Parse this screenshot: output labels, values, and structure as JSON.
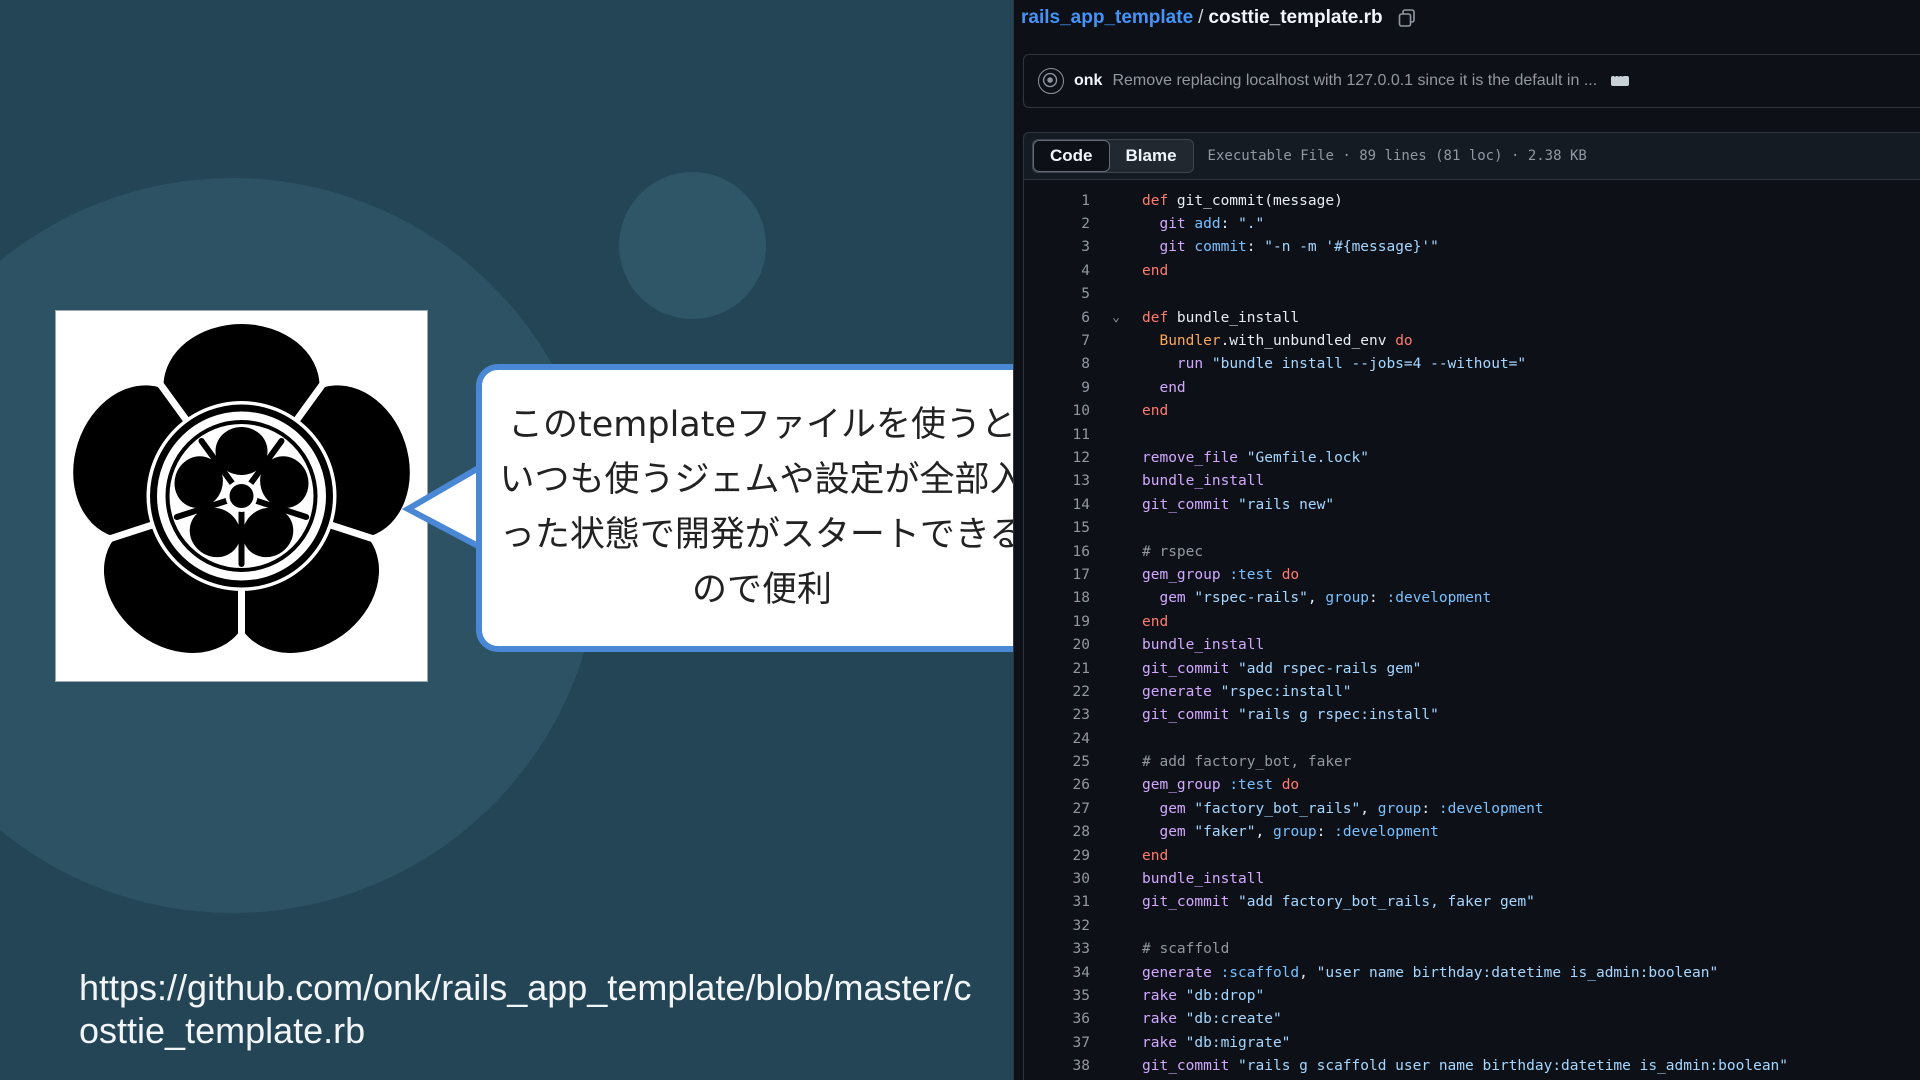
{
  "slide": {
    "bubble_text": "このtemplateファイルを使うといつも使うジェムや設定が全部入った状態で開発がスタートできるので便利",
    "url": "https://github.com/onk/rails_app_template/blob/master/costtie_template.rb",
    "colors": {
      "background": "#234556",
      "bubble_border": "#4a88d6"
    },
    "logo_icon": "family-crest-icon"
  },
  "viewer": {
    "breadcrumb": {
      "repo": "rails_app_template",
      "separator": "/",
      "file": "costtie_template.rb",
      "copy_icon": "copy-icon"
    },
    "commit": {
      "author": "onk",
      "message": "Remove replacing localhost with 127.0.0.1 since it is the default in ...",
      "more_icon": "ellipsis-icon"
    },
    "tabs": [
      {
        "label": "Code",
        "active": true
      },
      {
        "label": "Blame",
        "active": false
      }
    ],
    "file_info": "Executable File · 89 lines (81 loc) · 2.38 KB",
    "colors": {
      "background": "#0d1117",
      "link": "#4493f8",
      "keyword": "#ff7b72",
      "string": "#a5d6ff",
      "function": "#d2a8ff",
      "symbol": "#79c0ff",
      "constant": "#ffa657"
    },
    "lines": [
      {
        "n": "1",
        "text": "def git_commit(message)"
      },
      {
        "n": "2",
        "text": "  git add: \".\""
      },
      {
        "n": "3",
        "text": "  git commit: \"-n -m '#{message}'\""
      },
      {
        "n": "4",
        "text": "end"
      },
      {
        "n": "5",
        "text": ""
      },
      {
        "n": "6",
        "text": "def bundle_install",
        "fold": "⌄"
      },
      {
        "n": "7",
        "text": "  Bundler.with_unbundled_env do"
      },
      {
        "n": "8",
        "text": "    run \"bundle install --jobs=4 --without=\""
      },
      {
        "n": "9",
        "text": "  end"
      },
      {
        "n": "10",
        "text": "end"
      },
      {
        "n": "11",
        "text": ""
      },
      {
        "n": "12",
        "text": "remove_file \"Gemfile.lock\""
      },
      {
        "n": "13",
        "text": "bundle_install"
      },
      {
        "n": "14",
        "text": "git_commit \"rails new\""
      },
      {
        "n": "15",
        "text": ""
      },
      {
        "n": "16",
        "text": "# rspec",
        "kind": "comment"
      },
      {
        "n": "17",
        "text": "gem_group :test do"
      },
      {
        "n": "18",
        "text": "  gem \"rspec-rails\", group: :development"
      },
      {
        "n": "19",
        "text": "end"
      },
      {
        "n": "20",
        "text": "bundle_install"
      },
      {
        "n": "21",
        "text": "git_commit \"add rspec-rails gem\""
      },
      {
        "n": "22",
        "text": "generate \"rspec:install\""
      },
      {
        "n": "23",
        "text": "git_commit \"rails g rspec:install\""
      },
      {
        "n": "24",
        "text": ""
      },
      {
        "n": "25",
        "text": "# add factory_bot, faker",
        "kind": "comment"
      },
      {
        "n": "26",
        "text": "gem_group :test do"
      },
      {
        "n": "27",
        "text": "  gem \"factory_bot_rails\", group: :development"
      },
      {
        "n": "28",
        "text": "  gem \"faker\", group: :development"
      },
      {
        "n": "29",
        "text": "end"
      },
      {
        "n": "30",
        "text": "bundle_install"
      },
      {
        "n": "31",
        "text": "git_commit \"add factory_bot_rails, faker gem\""
      },
      {
        "n": "32",
        "text": ""
      },
      {
        "n": "33",
        "text": "# scaffold",
        "kind": "comment"
      },
      {
        "n": "34",
        "text": "generate :scaffold, \"user name birthday:datetime is_admin:boolean\""
      },
      {
        "n": "35",
        "text": "rake \"db:drop\""
      },
      {
        "n": "36",
        "text": "rake \"db:create\""
      },
      {
        "n": "37",
        "text": "rake \"db:migrate\""
      },
      {
        "n": "38",
        "text": "git_commit \"rails g scaffold user name birthday:datetime is_admin:boolean\""
      }
    ]
  }
}
